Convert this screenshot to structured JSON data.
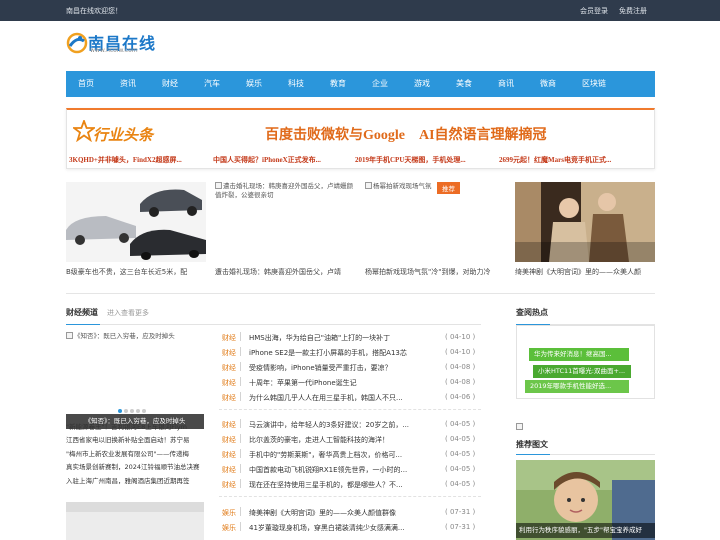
{
  "topbar": {
    "welcome": "南昌在线欢迎您！",
    "login": "会员登录",
    "register": "免费注册"
  },
  "logo": {
    "name": "南昌在线",
    "url": "www.ncolw.com"
  },
  "nav": [
    "首页",
    "资讯",
    "财经",
    "汽车",
    "娱乐",
    "科技",
    "教育",
    "企业",
    "游戏",
    "美食",
    "商讯",
    "微商",
    "区块链"
  ],
  "headline": {
    "badge": "行业头条",
    "title": "百度击败微软与Google　AI自然语言理解摘冠",
    "subs": [
      "3KQHD+并非噱头，FindX2超感屏...",
      "中国人买得起？iPhoneX正式发布...",
      "2019年手机CPU天梯图，手机处理...",
      "2699元起！红魔Mars电竞手机正式..."
    ]
  },
  "photos": [
    {
      "caption": "B级豪车也不贵，这三台车长近5米，配"
    },
    {
      "alt": "遭击婚礼现场：韩庚喜迎外国岳父，卢靖姗颜值炸裂，公婆很亲切",
      "caption": "遭击婚礼现场：韩庚喜迎外国岳父，卢靖"
    },
    {
      "alt": "杨幂拍新戏现场气氛",
      "caption": "杨幂拍新戏现场气氛\"冷\"到爆，对助力冷",
      "badge": "推荐"
    },
    {
      "caption": "绮美神剧《大明宫词》里的——众美人颜"
    }
  ],
  "finance": {
    "title": "财经频道",
    "more": "进入查看更多",
    "slider_alt": "《知否》：既已入穷巷，应及时掉头",
    "slider_caption": "《知否》：既已入穷巷，应及时掉头",
    "left_news": [
      "\"新能源卷王\"！吉利银河E8上车银河Flym",
      "江西省家电以旧换新补贴全面启动！苏宁易",
      "\"梅州市上新农业发展有限公司\"——传递梅",
      "真实场景创新赛制，2024江铃福顺节油总决赛",
      "入驻上海广州南昌，雅阁酒店集团近期再签"
    ],
    "list1": [
      {
        "cat": "财经",
        "title": "HMS出海，华为给自己\"油箱\"上打的一块补丁",
        "date": "( 04-10 )"
      },
      {
        "cat": "财经",
        "title": "iPhone SE2是一款主打小屏幕的手机，搭配A13芯",
        "date": "( 04-10 )"
      },
      {
        "cat": "财经",
        "title": "受疫情影响，iPhone销量受严重打击，要凉？",
        "date": "( 04-08 )"
      },
      {
        "cat": "财经",
        "title": "十周年：苹果第一代iPhone诞生记",
        "date": "( 04-08 )"
      },
      {
        "cat": "财经",
        "title": "为什么韩国几乎人人在用三星手机，韩国人不只...",
        "date": "( 04-06 )"
      }
    ],
    "list2": [
      {
        "cat": "财经",
        "title": "马云演讲中，给年轻人的3条好建议：20岁之前，...",
        "date": "( 04-05 )"
      },
      {
        "cat": "财经",
        "title": "比尔盖茨的豪宅，走进人工智能科技的海洋！",
        "date": "( 04-05 )"
      },
      {
        "cat": "财经",
        "title": "手机中的\"劳斯莱斯\"，奢华高贵上档次，价格可...",
        "date": "( 04-05 )"
      },
      {
        "cat": "财经",
        "title": "中国首款电动飞机锐翔RX1E领先世界，一小时的...",
        "date": "( 04-05 )"
      },
      {
        "cat": "财经",
        "title": "现在还在坚持使用三星手机的，都是哪些人？不...",
        "date": "( 04-05 )"
      }
    ],
    "list3": [
      {
        "cat": "娱乐",
        "title": "绮美神剧《大明宫词》里的——众美人颜值群像",
        "date": "( 07-31 )"
      },
      {
        "cat": "娱乐",
        "title": "41岁董璇现身机场，穿黑白裙装清纯少女感满满...",
        "date": "( 07-31 )"
      }
    ]
  },
  "sidebar": {
    "hot_title": "查阅热点",
    "hot_tags": [
      "华为传来好消息！继高国...",
      "小米HTC11首曝光:双曲面+...",
      "2019年哪款手机性能好选..."
    ],
    "pics_title": "推荐图文",
    "pic_caption": "利用行为秩序貌感丽，\"五步\"帮宝宝养成好"
  },
  "colors": {
    "nav": "#2b96db",
    "topbar": "#2f3b4c",
    "accent": "#f07a2d",
    "tag_green": "#5bbf3a"
  }
}
